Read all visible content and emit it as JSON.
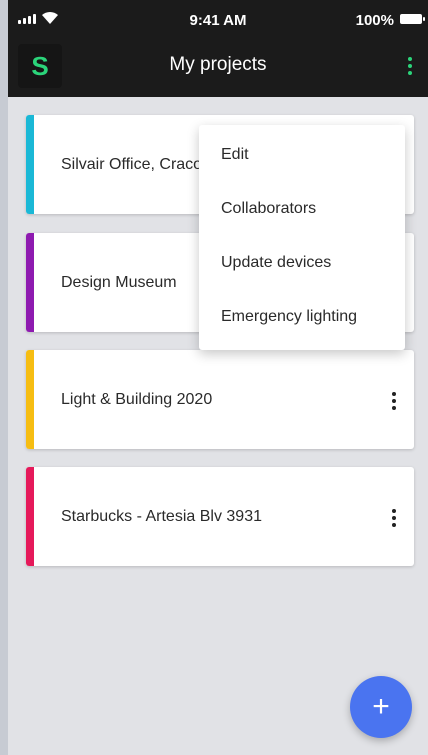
{
  "status_bar": {
    "time": "9:41 AM",
    "battery": "100%"
  },
  "app_bar": {
    "logo_letter": "S",
    "title": "My projects",
    "menu_icon": "more-vert-icon"
  },
  "projects": [
    {
      "name": "Silvair Office, Cracow",
      "accent": "#1ab8d6"
    },
    {
      "name": "Design Museum",
      "accent": "#8e1ab0"
    },
    {
      "name": "Light & Building 2020",
      "accent": "#f6bd12"
    },
    {
      "name": "Starbucks - Artesia Blv 3931",
      "accent": "#e5195a"
    }
  ],
  "context_menu": {
    "items": [
      "Edit",
      "Collaborators",
      "Update devices",
      "Emergency lighting"
    ]
  },
  "fab": {
    "label": "+",
    "color": "#4a74f0"
  },
  "colors": {
    "app_bar_bg": "#1b1b1b",
    "brand_green": "#2bd47a",
    "page_bg": "#e1e2e6"
  }
}
